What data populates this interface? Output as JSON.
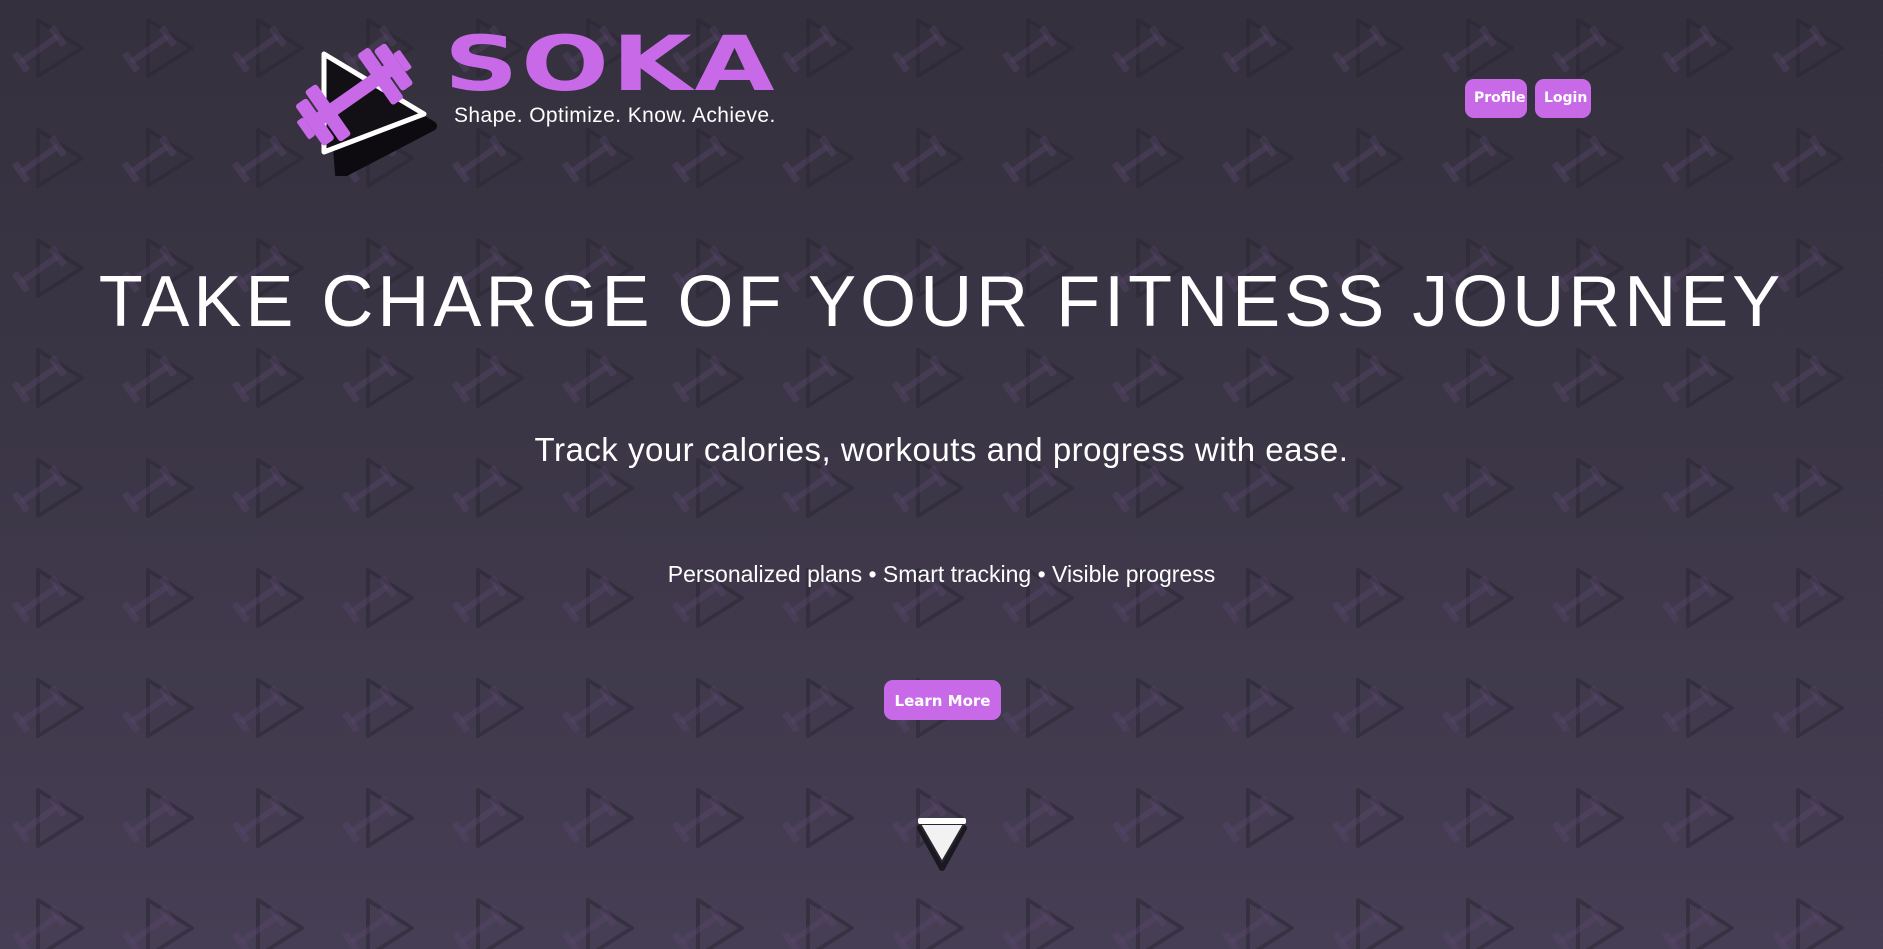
{
  "brand": {
    "name": "SOKA",
    "tagline": "Shape. Optimize. Know. Achieve.",
    "logo_icon": "dumbbell-play-icon"
  },
  "nav": {
    "profile_label": "Profile",
    "login_label": "Login"
  },
  "hero": {
    "title": "TAKE CHARGE OF YOUR FITNESS JOURNEY",
    "subtitle": "Track your calories, workouts and progress with ease.",
    "features": "Personalized plans • Smart tracking • Visible progress",
    "cta_label": "Learn More",
    "scroll_icon": "chevron-down-icon"
  },
  "colors": {
    "accent": "#c86ae8",
    "background_top": "#34303d",
    "background_bottom": "#463e54",
    "text": "#ffffff"
  }
}
